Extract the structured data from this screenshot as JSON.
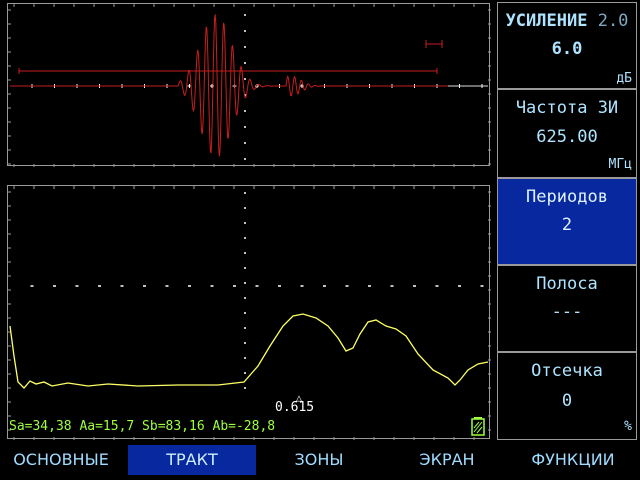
{
  "colors": {
    "frame": "#9a9a9a",
    "signal": "#c81e1e",
    "envelope": "#ffff66",
    "grid": "#ffffff",
    "status_text": "#9fff3f",
    "panel_text": "#aee4ff",
    "active_bg": "#0828a0"
  },
  "panels": [
    {
      "title": "УСИЛЕНИЕ",
      "suffix": "2.0",
      "value": "6.0",
      "unit": "дБ",
      "active": false
    },
    {
      "title": "Частота ЗИ",
      "value": "625.00",
      "unit": "МГц",
      "active": false
    },
    {
      "title": "Периодов",
      "value": "2",
      "unit": "",
      "active": true
    },
    {
      "title": "Полоса",
      "value": "---",
      "unit": "",
      "active": false
    },
    {
      "title": "Отсечка",
      "value": "0",
      "unit": "%",
      "active": false
    }
  ],
  "status": {
    "line": "Sa=34,38 Aa=15,7 Sb=83,16 Ab=-28,8",
    "cursor_value": "0.615",
    "battery_icon": "battery-icon"
  },
  "menu": [
    {
      "label": "ОСНОВНЫЕ",
      "selected": false
    },
    {
      "label": "ТРАКТ",
      "selected": true
    },
    {
      "label": "ЗОНЫ",
      "selected": false
    },
    {
      "label": "ЭКРАН",
      "selected": false
    },
    {
      "label": "ФУНКЦИИ",
      "selected": false
    }
  ]
}
